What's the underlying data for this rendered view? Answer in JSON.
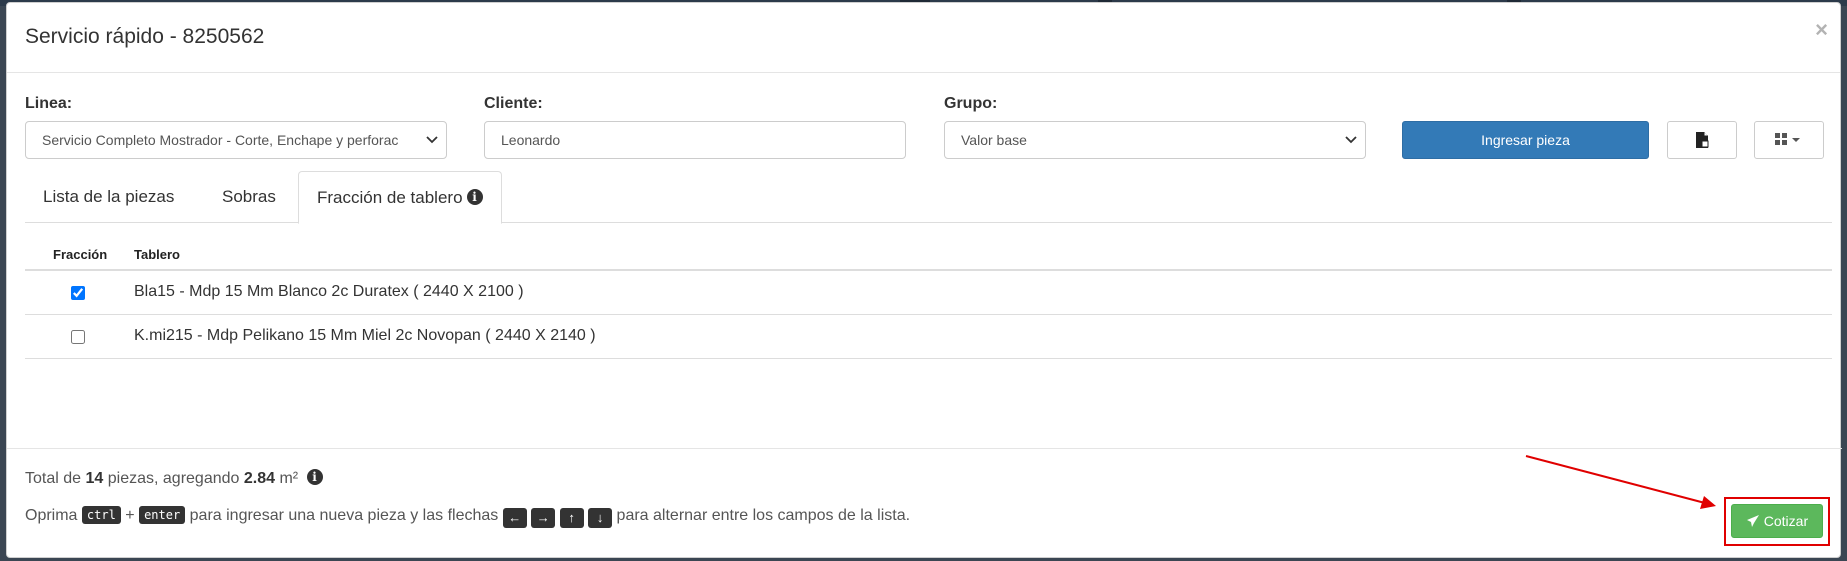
{
  "modal": {
    "title": "Servicio rápido - 8250562",
    "close_symbol": "×"
  },
  "form": {
    "linea": {
      "label": "Linea:",
      "value": "Servicio Completo Mostrador - Corte, Enchape y perforac"
    },
    "cliente": {
      "label": "Cliente:",
      "value": "Leonardo"
    },
    "grupo": {
      "label": "Grupo:",
      "value": "Valor base"
    },
    "add_button": "Ingresar pieza"
  },
  "tabs": [
    {
      "label": "Lista de la piezas"
    },
    {
      "label": "Sobras"
    },
    {
      "label": "Fracción de tablero",
      "active": true
    }
  ],
  "table": {
    "headers": [
      "Fracción",
      "Tablero"
    ],
    "rows": [
      {
        "checked": true,
        "code": "Bla15",
        "description": " - Mdp 15 Mm Blanco 2c Duratex ( 2440 X 2100 )"
      },
      {
        "checked": false,
        "code": "K.mi215",
        "description": " - Mdp Pelikano 15 Mm Miel 2c Novopan ( 2440 X 2140 )"
      }
    ]
  },
  "footer": {
    "total_prefix": "Total de",
    "pieces": "14",
    "pieces_suffix": "piezas, agregando",
    "area": "2.84",
    "area_unit": "m²",
    "hint_prefix": "Oprima",
    "key_ctrl": "ctrl",
    "plus": "+",
    "key_enter": "enter",
    "hint_middle": "para ingresar una nueva pieza y las flechas",
    "hint_suffix": "para alternar entre los campos de la lista.",
    "submit_label": "Cotizar"
  },
  "colors": {
    "primary": "#337ab7",
    "success": "#5cb85c",
    "annotation": "#e00000"
  }
}
